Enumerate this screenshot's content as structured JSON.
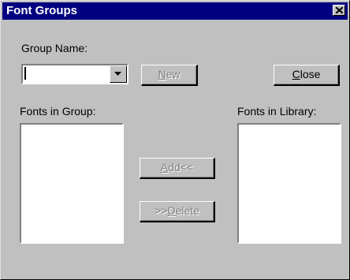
{
  "window": {
    "title": "Font Groups",
    "close_glyph": "close-icon"
  },
  "group_name": {
    "label": "Group Name:",
    "value": ""
  },
  "buttons": {
    "new": {
      "ul": "N",
      "rest": "ew",
      "enabled": false
    },
    "close": {
      "ul": "C",
      "rest": "lose",
      "enabled": true
    },
    "add": {
      "ul": "A",
      "rest": "dd<<",
      "enabled": false
    },
    "delete_prefix": ">>",
    "delete": {
      "ul": "D",
      "rest": "elete",
      "enabled": false
    }
  },
  "lists": {
    "group_label": "Fonts in Group:",
    "library_label": "Fonts in Library:",
    "group_items": [],
    "library_items": []
  }
}
